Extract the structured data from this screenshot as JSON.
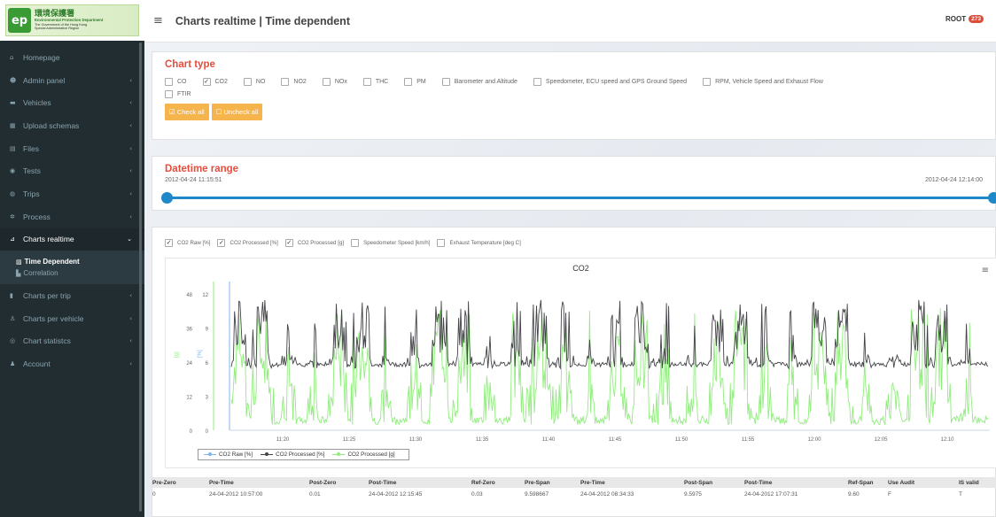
{
  "logo": {
    "cn": "環境保護署",
    "en": "Environmental Protection Department",
    "gov1": "The Government of the Hong Kong",
    "gov2": "Special Administrative Region"
  },
  "header": {
    "title": "Charts realtime | Time dependent",
    "user": "ROOT",
    "badge": "273"
  },
  "sidebar": {
    "items": [
      {
        "label": "Homepage",
        "icon": "home-icon"
      },
      {
        "label": "Admin panel",
        "icon": "users-icon"
      },
      {
        "label": "Vehicles",
        "icon": "car-icon"
      },
      {
        "label": "Upload schemas",
        "icon": "table-icon"
      },
      {
        "label": "Files",
        "icon": "file-icon"
      },
      {
        "label": "Tests",
        "icon": "eye-icon"
      },
      {
        "label": "Trips",
        "icon": "binoculars-icon"
      },
      {
        "label": "Process",
        "icon": "gear-icon"
      },
      {
        "label": "Charts realtime",
        "icon": "line-chart-icon"
      }
    ],
    "sub_items": [
      {
        "label": "Time Dependent",
        "icon": "area-chart-icon"
      },
      {
        "label": "Correlation",
        "icon": "bar-chart-icon"
      }
    ],
    "items_after": [
      {
        "label": "Charts per trip",
        "icon": "bar-chart-icon"
      },
      {
        "label": "Charts per vehicle",
        "icon": "user-icon"
      },
      {
        "label": "Chart statistcs",
        "icon": "globe-icon"
      },
      {
        "label": "Account",
        "icon": "user-icon"
      }
    ]
  },
  "chart_type": {
    "title": "Chart type",
    "options": [
      {
        "label": "CO",
        "checked": false
      },
      {
        "label": "CO2",
        "checked": true
      },
      {
        "label": "NO",
        "checked": false
      },
      {
        "label": "NO2",
        "checked": false
      },
      {
        "label": "NOx",
        "checked": false
      },
      {
        "label": "THC",
        "checked": false
      },
      {
        "label": "PM",
        "checked": false
      },
      {
        "label": "Barometer and Altitude",
        "checked": false
      },
      {
        "label": "Speedometer, ECU speed and GPS Ground Speed",
        "checked": false
      },
      {
        "label": "RPM, Vehicle Speed and Exhaust Flow",
        "checked": false
      },
      {
        "label": "FTIR",
        "checked": false
      }
    ],
    "check_all": "Check all",
    "uncheck_all": "Uncheck all"
  },
  "datetime_range": {
    "title": "Datetime range",
    "start": "2012-04-24 11:15:51",
    "end": "2012-04-24 12:14:00"
  },
  "series_toggles": [
    {
      "label": "CO2 Raw [%]",
      "checked": true
    },
    {
      "label": "CO2 Processed [%]",
      "checked": true
    },
    {
      "label": "CO2 Processed [g]",
      "checked": true
    },
    {
      "label": "Speedometer Speed [km/h]",
      "checked": false
    },
    {
      "label": "Exhaust Temperature [deg C]",
      "checked": false
    }
  ],
  "chart_data": {
    "type": "line",
    "title": "CO2",
    "x_ticks": [
      "11:20",
      "11:25",
      "11:30",
      "11:35",
      "11:40",
      "11:45",
      "11:50",
      "11:55",
      "12:00",
      "12:05",
      "12:10"
    ],
    "y_left_ticks": [
      "0",
      "12",
      "24",
      "36",
      "48"
    ],
    "y_right_ticks": [
      "0",
      "3",
      "6",
      "9",
      "12"
    ],
    "y_left_label": "[g]",
    "y_right_label": "[%]",
    "y_left_range": [
      0,
      48
    ],
    "y_right_range": [
      0,
      12
    ],
    "series": [
      {
        "name": "CO2 Raw [%]",
        "color": "#7cb5ec",
        "values": []
      },
      {
        "name": "CO2 Processed [%]",
        "color": "#434348",
        "baseline": 5.8,
        "peak": 11.5
      },
      {
        "name": "CO2 Processed [g]",
        "color": "#90ed7d",
        "baseline": 2,
        "peak": 43
      }
    ],
    "legend_position": "bottom-left"
  },
  "table": {
    "headers": [
      "Pre-Zero",
      "Pre-Time",
      "Post-Zero",
      "Post-Time",
      "Ref-Zero",
      "Pre-Span",
      "Pre-Time",
      "Post-Span",
      "Post-Time",
      "Ref-Span",
      "Use Audit",
      "IS valid"
    ],
    "rows": [
      [
        "0",
        "24-04-2012 10:57:00",
        "0.01",
        "24-04-2012 12:15:45",
        "0.03",
        "9.598667",
        "24-04-2012 08:34:33",
        "9.5975",
        "24-04-2012 17:07:31",
        "9.60",
        "F",
        "T"
      ]
    ]
  }
}
